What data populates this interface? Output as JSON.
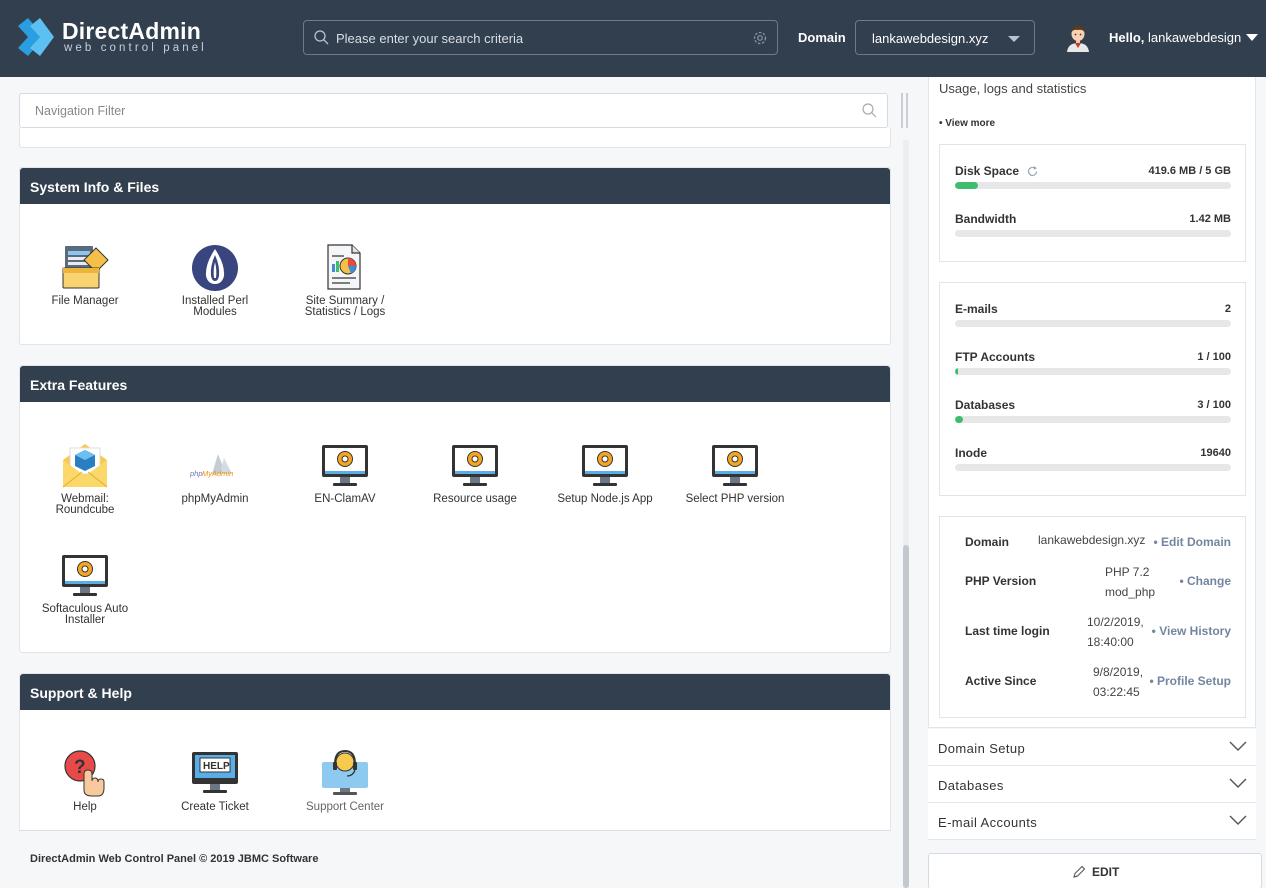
{
  "header": {
    "logo_title": "DirectAdmin",
    "logo_subtitle": "web control panel",
    "search_placeholder": "Please enter your search criteria",
    "domain_label": "Domain",
    "domain_value": "lankawebdesign.xyz",
    "hello_prefix": "Hello,",
    "username": "lankawebdesign"
  },
  "nav_filter": {
    "placeholder": "Navigation Filter"
  },
  "sections": {
    "system": {
      "title": "System Info & Files",
      "tiles": [
        "File Manager",
        "Installed Perl Modules",
        "Site Summary / Statistics / Logs"
      ]
    },
    "extra": {
      "title": "Extra Features",
      "tiles": [
        "Webmail: Roundcube",
        "phpMyAdmin",
        "EN-ClamAV",
        "Resource usage",
        "Setup Node.js App",
        "Select PHP version",
        "Softaculous Auto Installer"
      ]
    },
    "support": {
      "title": "Support & Help",
      "tiles": [
        "Help",
        "Create Ticket",
        "Support Center"
      ]
    }
  },
  "footer": "DirectAdmin Web Control Panel © 2019 JBMC Software",
  "sidebar": {
    "usage_title": "Usage, logs and statistics",
    "view_more": "• View more",
    "disk": {
      "label": "Disk Space",
      "value": "419.6 MB / 5 GB",
      "fraction": 0.082
    },
    "bandwidth": {
      "label": "Bandwidth",
      "value": "1.42 MB",
      "fraction": 0.0
    },
    "emails": {
      "label": "E-mails",
      "value": "2",
      "fraction": 0.0
    },
    "ftp": {
      "label": "FTP Accounts",
      "value": "1 / 100",
      "fraction": 0.01
    },
    "databases": {
      "label": "Databases",
      "value": "3 / 100",
      "fraction": 0.03
    },
    "inode": {
      "label": "Inode",
      "value": "19640",
      "fraction": 0.0
    },
    "info": {
      "domain": {
        "label": "Domain",
        "value": "lankawebdesign.xyz",
        "action": "• Edit Domain"
      },
      "php": {
        "label": "PHP Version",
        "value1": "PHP 7.2",
        "value2": "mod_php",
        "action": "• Change"
      },
      "login": {
        "label": "Last time login",
        "value1": "10/2/2019,",
        "value2": "18:40:00",
        "action": "• View History"
      },
      "since": {
        "label": "Active Since",
        "value1": "9/8/2019,",
        "value2": "03:22:45",
        "action": "• Profile Setup"
      }
    },
    "accordion": [
      "Domain Setup",
      "Databases",
      "E-mail Accounts"
    ],
    "edit_label": "EDIT"
  },
  "colors": {
    "header_bg": "#323f4f",
    "accent_blue": "#2a9ee0",
    "progress_green": "#3fbd6d",
    "link_slate": "#7286a0"
  }
}
